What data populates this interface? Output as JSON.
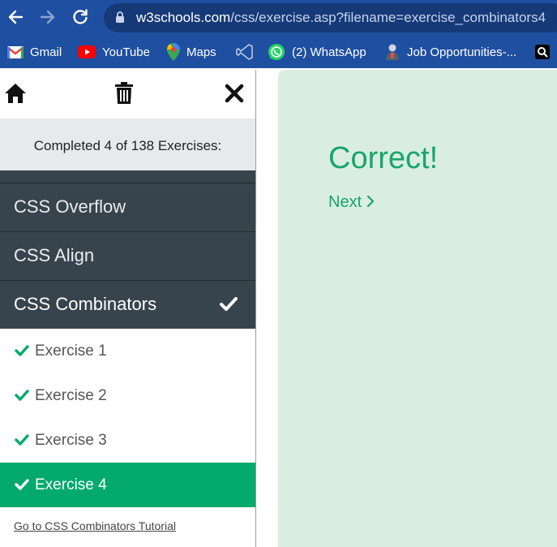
{
  "browser": {
    "url_host": "w3schools.com",
    "url_path": "/css/exercise.asp?filename=exercise_combinators4",
    "bookmarks": [
      {
        "label": "Gmail",
        "icon": "gmail-icon"
      },
      {
        "label": "YouTube",
        "icon": "youtube-icon"
      },
      {
        "label": "Maps",
        "icon": "maps-icon"
      },
      {
        "label": "",
        "icon": "vscode-icon"
      },
      {
        "label": "(2) WhatsApp",
        "icon": "whatsapp-icon"
      },
      {
        "label": "Job Opportunities-...",
        "icon": "job-icon"
      },
      {
        "label": "",
        "icon": "app-icon"
      }
    ]
  },
  "sidebar": {
    "progress_text": "Completed 4 of 138 Exercises:",
    "categories": [
      {
        "label": "CSS Overflow"
      },
      {
        "label": "CSS Align"
      },
      {
        "label": "CSS Combinators"
      }
    ],
    "exercises": [
      {
        "label": "Exercise 1"
      },
      {
        "label": "Exercise 2"
      },
      {
        "label": "Exercise 3"
      },
      {
        "label": "Exercise 4"
      }
    ],
    "tutorial_link": "Go to CSS Combinators Tutorial"
  },
  "result": {
    "title": "Correct!",
    "next_label": "Next"
  },
  "colors": {
    "accent_green": "#04aa6d",
    "sidebar_dark": "#38444d",
    "result_bg": "#d9eee1",
    "chrome_blue": "#1f4fa0"
  }
}
